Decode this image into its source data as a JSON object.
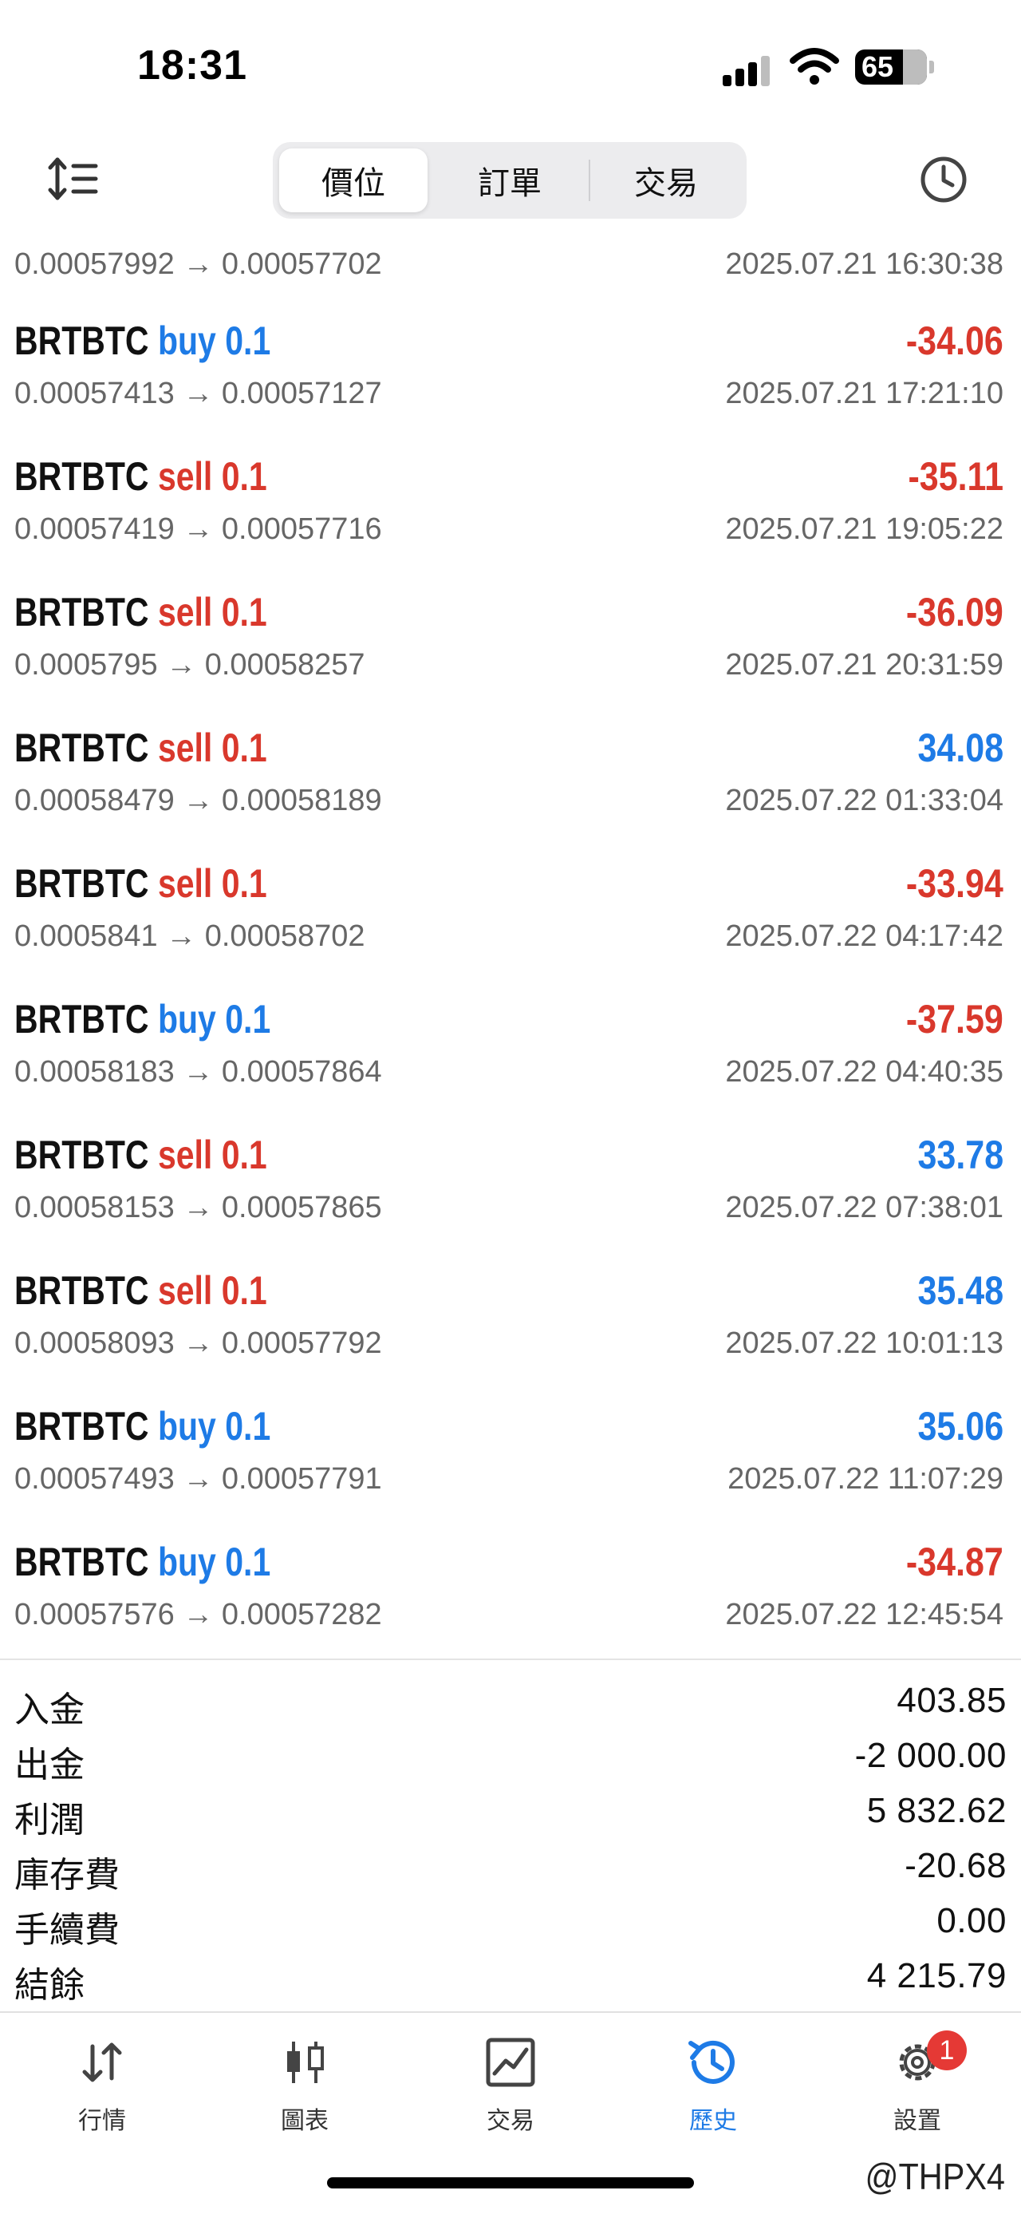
{
  "status_bar": {
    "time": "18:31",
    "battery": "65"
  },
  "toolbar": {
    "tabs": [
      {
        "label": "價位",
        "active": true
      },
      {
        "label": "訂單",
        "active": false
      },
      {
        "label": "交易",
        "active": false
      }
    ]
  },
  "history": {
    "first_partial": {
      "prices": "0.00057992 → 0.00057702",
      "time": "2025.07.21 16:30:38"
    },
    "rows": [
      {
        "symbol": "BRTBTC",
        "side": "buy",
        "volume": "0.1",
        "profit": "-34.06",
        "prices": "0.00057413 → 0.00057127",
        "time": "2025.07.21 17:21:10"
      },
      {
        "symbol": "BRTBTC",
        "side": "sell",
        "volume": "0.1",
        "profit": "-35.11",
        "prices": "0.00057419 → 0.00057716",
        "time": "2025.07.21 19:05:22"
      },
      {
        "symbol": "BRTBTC",
        "side": "sell",
        "volume": "0.1",
        "profit": "-36.09",
        "prices": "0.0005795 → 0.00058257",
        "time": "2025.07.21 20:31:59"
      },
      {
        "symbol": "BRTBTC",
        "side": "sell",
        "volume": "0.1",
        "profit": "34.08",
        "prices": "0.00058479 → 0.00058189",
        "time": "2025.07.22 01:33:04"
      },
      {
        "symbol": "BRTBTC",
        "side": "sell",
        "volume": "0.1",
        "profit": "-33.94",
        "prices": "0.0005841 → 0.00058702",
        "time": "2025.07.22 04:17:42"
      },
      {
        "symbol": "BRTBTC",
        "side": "buy",
        "volume": "0.1",
        "profit": "-37.59",
        "prices": "0.00058183 → 0.00057864",
        "time": "2025.07.22 04:40:35"
      },
      {
        "symbol": "BRTBTC",
        "side": "sell",
        "volume": "0.1",
        "profit": "33.78",
        "prices": "0.00058153 → 0.00057865",
        "time": "2025.07.22 07:38:01"
      },
      {
        "symbol": "BRTBTC",
        "side": "sell",
        "volume": "0.1",
        "profit": "35.48",
        "prices": "0.00058093 → 0.00057792",
        "time": "2025.07.22 10:01:13"
      },
      {
        "symbol": "BRTBTC",
        "side": "buy",
        "volume": "0.1",
        "profit": "35.06",
        "prices": "0.00057493 → 0.00057791",
        "time": "2025.07.22 11:07:29"
      },
      {
        "symbol": "BRTBTC",
        "side": "buy",
        "volume": "0.1",
        "profit": "-34.87",
        "prices": "0.00057576 → 0.00057282",
        "time": "2025.07.22 12:45:54"
      }
    ]
  },
  "summary": [
    {
      "label": "入金",
      "value": "403.85"
    },
    {
      "label": "出金",
      "value": "-2 000.00"
    },
    {
      "label": "利潤",
      "value": "5 832.62"
    },
    {
      "label": "庫存費",
      "value": "-20.68"
    },
    {
      "label": "手續費",
      "value": "0.00"
    },
    {
      "label": "結餘",
      "value": "4 215.79"
    }
  ],
  "bottom_nav": [
    {
      "label": "行情",
      "icon": "quotes-arrows-icon",
      "active": false
    },
    {
      "label": "圖表",
      "icon": "candlestick-chart-icon",
      "active": false
    },
    {
      "label": "交易",
      "icon": "trade-chart-icon",
      "active": false
    },
    {
      "label": "歷史",
      "icon": "history-clock-icon",
      "active": true
    },
    {
      "label": "設置",
      "icon": "gear-icon",
      "active": false,
      "badge": "1"
    }
  ],
  "watermark": "@THPX4",
  "colors": {
    "buy": "#1e7be6",
    "sell": "#d9382c",
    "active_tab": "#1e7be6"
  }
}
